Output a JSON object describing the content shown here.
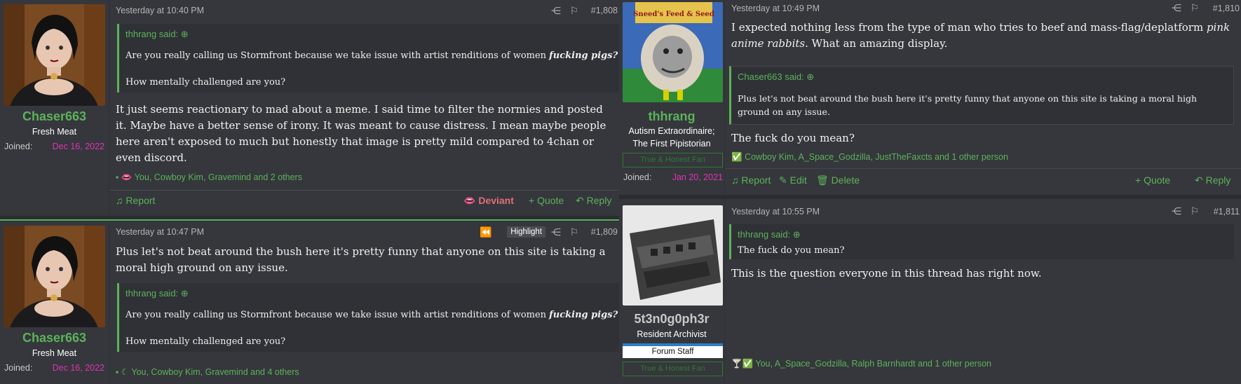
{
  "left": {
    "post1": {
      "user": {
        "name": "Chaser663",
        "title": "Fresh Meat",
        "joined_label": "Joined:",
        "joined_value": "Dec 16, 2022"
      },
      "time": "Yesterday at 10:40 PM",
      "number": "#1,808",
      "quote": {
        "author": "thhrang said:",
        "line1_pre": "Are you really calling us Stormfront because we take issue with artist renditions of women ",
        "line1_em": "fucking pigs?",
        "line2": "How mentally challenged are you?"
      },
      "body": "It just seems reactionary to mad about a meme. I said time to filter the normies and posted it. Maybe have a better sense of irony. It was meant to cause distress. I mean maybe people here aren't exposed to much but honestly that image is pretty mild compared to 4chan or even discord.",
      "reactions": "You, Cowboy Kim, Gravemind and 2 others",
      "actions": {
        "report": "Report",
        "deviant": "Deviant",
        "quote": "+ Quote",
        "reply": "Reply"
      }
    },
    "post2": {
      "user": {
        "name": "Chaser663",
        "title": "Fresh Meat",
        "joined_label": "Joined:",
        "joined_value": "Dec 16, 2022"
      },
      "time": "Yesterday at 10:47 PM",
      "highlight": "Highlight",
      "number": "#1,809",
      "body": "Plus let's not beat around the bush here it's pretty funny that anyone on this site is taking a moral high ground on any issue.",
      "quote": {
        "author": "thhrang said:",
        "line1_pre": "Are you really calling us Stormfront because we take issue with artist renditions of women ",
        "line1_em": "fucking pigs?",
        "line2": "How mentally challenged are you?"
      },
      "reactions": "You, Cowboy Kim, Gravemind and 4 others"
    }
  },
  "right": {
    "post1": {
      "user": {
        "name": "thhrang",
        "title1": "Autism Extraordinaire;",
        "title2": "The First Pipistorian",
        "banner": "True & Honest Fan",
        "joined_label": "Joined:",
        "joined_value": "Jan 20, 2021"
      },
      "time": "Yesterday at 10:49 PM",
      "number": "#1,810",
      "body_pre": "I expected nothing less from the type of man who tries to beef and mass-flag/deplatform ",
      "body_em": "pink anime rabbits",
      "body_post": ". What an amazing display.",
      "quote": {
        "author": "Chaser663 said:",
        "text": "Plus let's not beat around the bush here it's pretty funny that anyone on this site is taking a moral high ground on any issue."
      },
      "body2": "The fuck do you mean?",
      "reactions": "Cowboy Kim, A_Space_Godzilla, JustTheFaxcts and 1 other person",
      "actions": {
        "report": "Report",
        "edit": "Edit",
        "delete": "Delete",
        "quote": "+ Quote",
        "reply": "Reply"
      }
    },
    "post2": {
      "user": {
        "name": "5t3n0g0ph3r",
        "title": "Resident Archivist",
        "staff": "Forum Staff",
        "banner": "True & Honest Fan"
      },
      "time": "Yesterday at 10:55 PM",
      "number": "#1,811",
      "quote": {
        "author": "thhrang said:",
        "text": "The fuck do you mean?"
      },
      "body": "This is the question everyone in this thread has right now.",
      "reactions": "You, A_Space_Godzilla, Ralph Barnhardt and 1 other person"
    },
    "sign": "Sneed's Feed & Seed"
  },
  "colors": {
    "accent": "#5cb25a",
    "joined": "#e033b5",
    "deviant": "#e0707a",
    "bg": "#2a2c30",
    "panel": "#35373c"
  }
}
